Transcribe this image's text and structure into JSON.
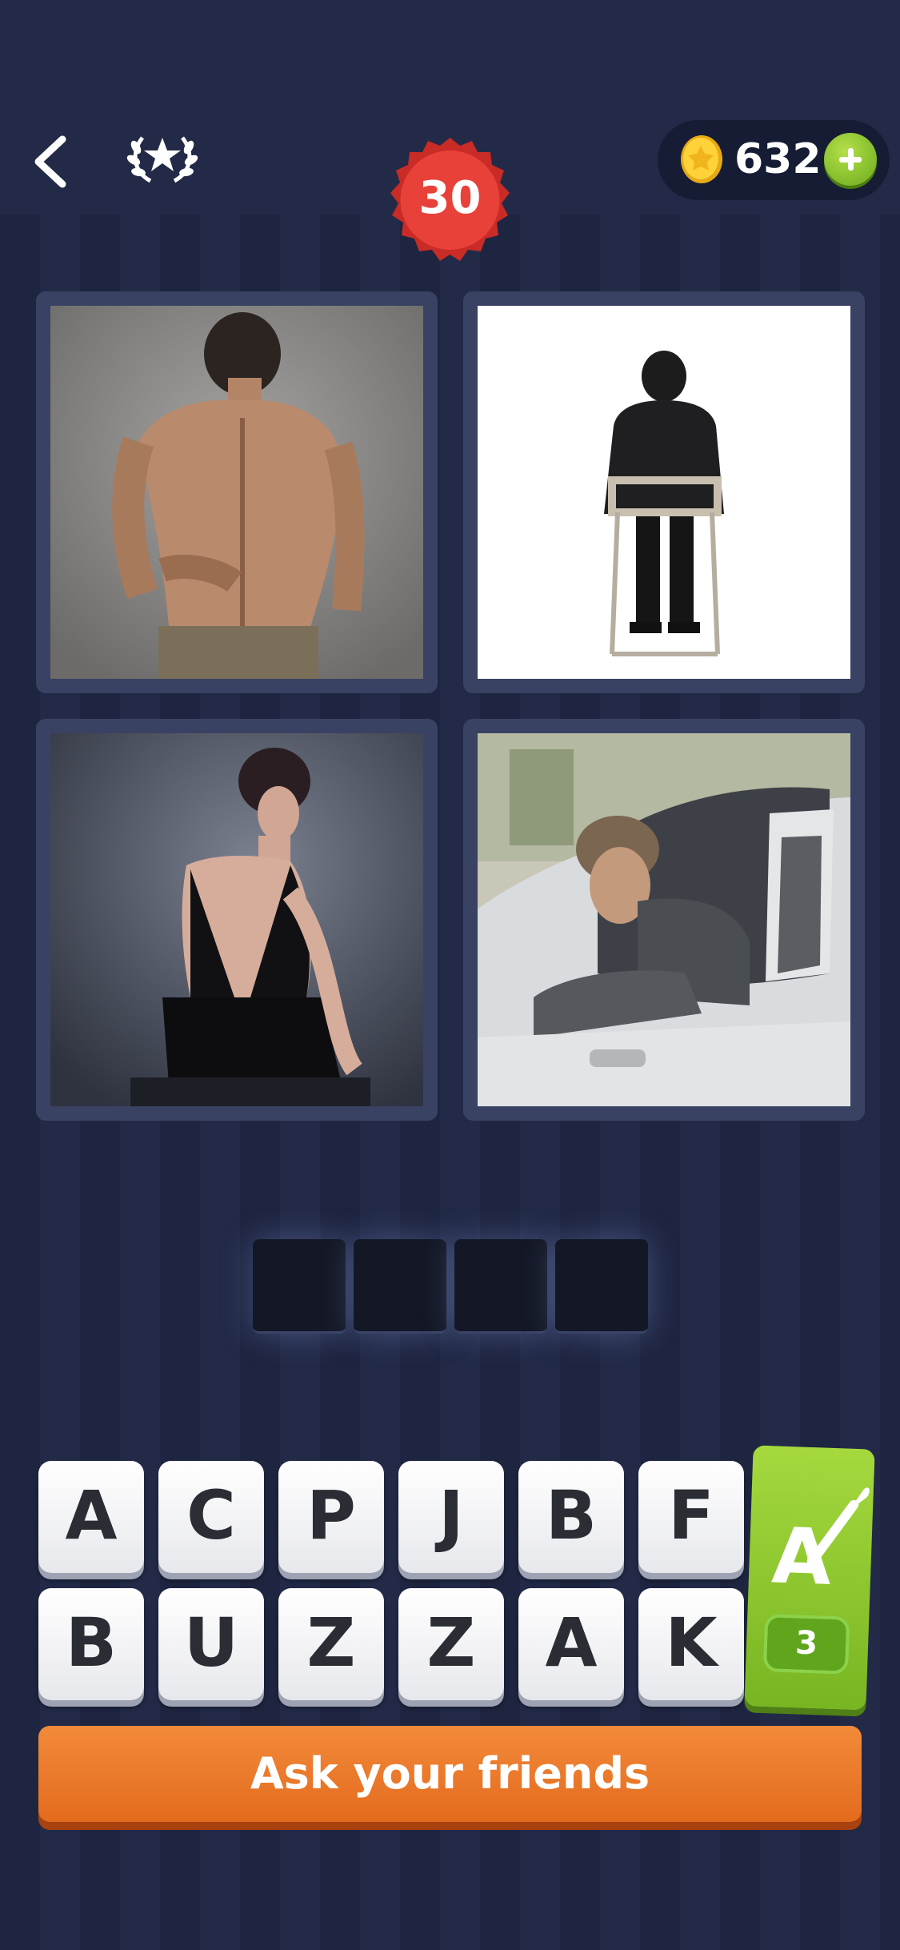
{
  "header": {
    "back_icon": "chevron-left-icon",
    "achievements_icon": "laurel-star-icon",
    "level": "30",
    "coins": "632",
    "coin_icon": "gold-coin-icon",
    "add_coins_icon": "plus-icon"
  },
  "puzzle": {
    "photos": [
      {
        "depicts": "shirtless man holding lower back",
        "icon": "photo"
      },
      {
        "depicts": "man in suit seated on folding chair from behind",
        "icon": "photo"
      },
      {
        "depicts": "woman in backless black dress",
        "icon": "photo"
      },
      {
        "depicts": "man looking back out of car window",
        "icon": "photo"
      }
    ],
    "answer_length": 4
  },
  "keyboard": {
    "row1": [
      "A",
      "C",
      "P",
      "J",
      "B",
      "F"
    ],
    "row2": [
      "B",
      "U",
      "Z",
      "Z",
      "A",
      "K"
    ]
  },
  "hint": {
    "icon": "letter-brush-icon",
    "count": "3"
  },
  "ask_button_label": "Ask your friends",
  "colors": {
    "background": "#1e2540",
    "level_badge": "#e23a33",
    "hint_green": "#8cc832",
    "ask_orange": "#ee7a2c"
  }
}
